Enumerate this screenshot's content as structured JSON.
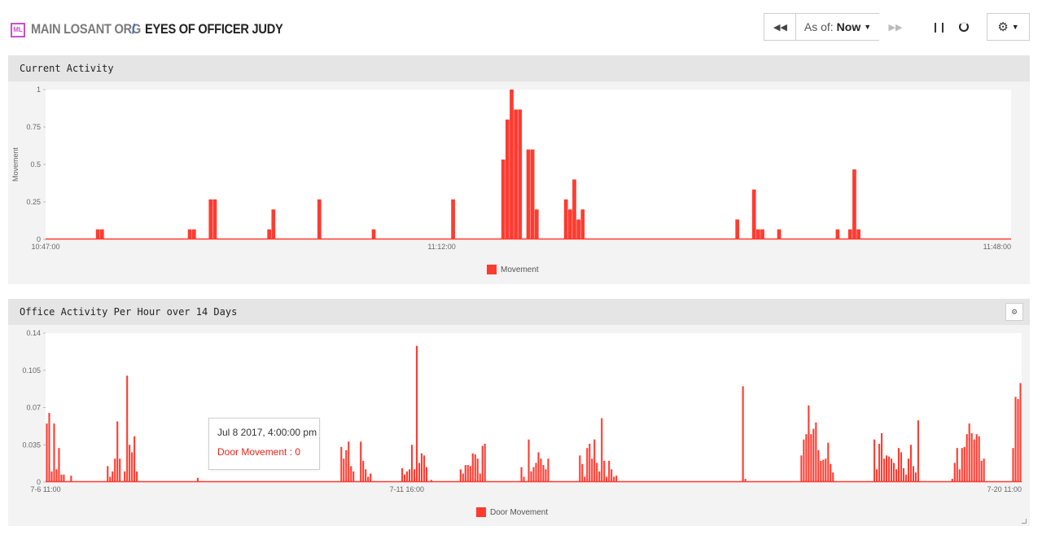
{
  "header": {
    "logo_text": "ML",
    "org_name": "MAIN LOSANT ORG",
    "separator": "/",
    "dashboard_name": "EYES OF OFFICER JUDY",
    "controls": {
      "rewind_icon": "rewind-icon",
      "as_of_label": "As of:",
      "as_of_value": "Now",
      "forward_icon": "fast-forward-icon",
      "pause_icon": "pause-icon",
      "refresh_icon": "loading-spinner-icon",
      "settings_icon": "gear-icon"
    }
  },
  "colors": {
    "bar": "#ff3b30",
    "tooltip_value": "#e8261b",
    "separator": "#2e6bd6",
    "logo": "#c94fd0"
  },
  "panels": [
    {
      "title": "Current Activity",
      "legend": "Movement"
    },
    {
      "title": "Office Activity Per Hour over 14 Days",
      "legend": "Door Movement",
      "tooltip": {
        "date": "Jul 8 2017, 4:00:00 pm",
        "series": "Door Movement",
        "value": "0"
      }
    }
  ],
  "chart_data": [
    {
      "type": "bar",
      "ylabel": "Movement",
      "ylim": [
        0,
        1
      ],
      "yticks": [
        "0",
        "0.25",
        "0.5",
        "0.75",
        "1"
      ],
      "xticks": [
        "10:47:00",
        "11:12:00",
        "11:48:00"
      ],
      "xtick_pos": [
        0,
        0.4103,
        1
      ],
      "legend": "top-bottom-center",
      "series": [
        {
          "name": "Movement",
          "values": [
            0,
            0,
            0,
            0,
            0,
            0,
            0,
            0,
            0,
            0,
            0,
            0,
            0.067,
            0.067,
            0,
            0,
            0,
            0,
            0,
            0,
            0,
            0,
            0,
            0,
            0,
            0,
            0,
            0,
            0,
            0,
            0,
            0,
            0,
            0,
            0.067,
            0.067,
            0,
            0,
            0,
            0.267,
            0.267,
            0,
            0,
            0,
            0,
            0,
            0,
            0,
            0,
            0,
            0,
            0,
            0,
            0.067,
            0.2,
            0,
            0,
            0,
            0,
            0,
            0,
            0,
            0,
            0,
            0,
            0.267,
            0,
            0,
            0,
            0,
            0,
            0,
            0,
            0,
            0,
            0,
            0,
            0,
            0.067,
            0,
            0,
            0,
            0,
            0,
            0,
            0,
            0,
            0,
            0,
            0,
            0,
            0,
            0,
            0,
            0,
            0,
            0,
            0.267,
            0,
            0,
            0,
            0,
            0,
            0,
            0,
            0,
            0,
            0,
            0,
            0.533,
            0.8,
            1,
            0.867,
            0.867,
            0,
            0.6,
            0.6,
            0.2,
            0,
            0,
            0,
            0,
            0,
            0,
            0.267,
            0.2,
            0.4,
            0.133,
            0.2,
            0,
            0,
            0,
            0,
            0,
            0,
            0,
            0,
            0,
            0,
            0,
            0,
            0,
            0,
            0,
            0,
            0,
            0,
            0,
            0,
            0,
            0,
            0,
            0,
            0,
            0,
            0,
            0,
            0,
            0,
            0,
            0,
            0,
            0,
            0,
            0,
            0.133,
            0,
            0,
            0,
            0.333,
            0.067,
            0.067,
            0,
            0,
            0,
            0.067,
            0,
            0,
            0,
            0,
            0,
            0,
            0,
            0,
            0,
            0,
            0,
            0,
            0,
            0.067,
            0,
            0,
            0.067,
            0.467,
            0.067,
            0,
            0,
            0,
            0,
            0,
            0,
            0,
            0,
            0,
            0,
            0,
            0,
            0,
            0,
            0,
            0,
            0,
            0,
            0,
            0,
            0,
            0,
            0,
            0,
            0,
            0,
            0,
            0,
            0,
            0,
            0,
            0,
            0,
            0,
            0,
            0
          ]
        }
      ]
    },
    {
      "type": "bar",
      "ylim": [
        0,
        0.14
      ],
      "yticks": [
        "0",
        "0.035",
        "0.07",
        "0.105",
        "0.14"
      ],
      "xticks": [
        "7-6 11:00",
        "7-11 16:00",
        "7-20 11:00"
      ],
      "xtick_pos": [
        0,
        0.3702,
        1
      ],
      "legend": "bottom-center",
      "series": [
        {
          "name": "Door Movement",
          "values": [
            0.055,
            0.065,
            0.01,
            0.055,
            0.012,
            0.032,
            0.007,
            0.007,
            0,
            0,
            0.006,
            0,
            0,
            0,
            0,
            0,
            0,
            0,
            0,
            0,
            0,
            0,
            0,
            0,
            0,
            0.015,
            0.005,
            0.01,
            0.022,
            0.057,
            0.022,
            0,
            0.01,
            0.1,
            0.035,
            0.028,
            0.043,
            0.01,
            0,
            0,
            0,
            0,
            0,
            0,
            0,
            0,
            0,
            0,
            0,
            0,
            0,
            0,
            0,
            0,
            0,
            0,
            0,
            0,
            0,
            0,
            0,
            0,
            0.004,
            0,
            0,
            0,
            0,
            0,
            0,
            0,
            0,
            0,
            0,
            0,
            0,
            0,
            0,
            0,
            0,
            0,
            0,
            0,
            0,
            0,
            0,
            0,
            0,
            0,
            0,
            0,
            0,
            0,
            0,
            0,
            0,
            0,
            0,
            0,
            0,
            0,
            0,
            0,
            0,
            0,
            0,
            0,
            0,
            0,
            0,
            0,
            0,
            0,
            0,
            0,
            0,
            0,
            0,
            0,
            0,
            0,
            0,
            0.033,
            0.022,
            0.03,
            0.038,
            0.015,
            0.01,
            0,
            0,
            0.038,
            0.02,
            0.012,
            0.005,
            0.008,
            0,
            0,
            0,
            0,
            0,
            0,
            0,
            0,
            0,
            0,
            0,
            0,
            0.013,
            0.007,
            0.01,
            0.012,
            0.035,
            0.012,
            0.128,
            0.018,
            0.027,
            0.025,
            0.014,
            0,
            0.002,
            0,
            0,
            0,
            0,
            0,
            0,
            0,
            0,
            0,
            0,
            0,
            0.012,
            0.008,
            0.016,
            0.016,
            0.015,
            0.027,
            0.026,
            0.022,
            0.008,
            0.034,
            0.036,
            0,
            0,
            0,
            0,
            0,
            0,
            0,
            0,
            0,
            0,
            0,
            0,
            0,
            0,
            0.014,
            0.005,
            0,
            0.04,
            0.01,
            0.014,
            0.018,
            0.028,
            0.022,
            0.016,
            0.012,
            0.022,
            0,
            0,
            0,
            0,
            0,
            0,
            0,
            0,
            0,
            0,
            0,
            0,
            0.025,
            0.017,
            0.005,
            0.032,
            0.036,
            0.022,
            0.04,
            0.018,
            0.01,
            0.06,
            0.02,
            0.005,
            0.02,
            0.012,
            0.005,
            0.006,
            0,
            0,
            0,
            0,
            0,
            0,
            0,
            0,
            0,
            0,
            0,
            0,
            0,
            0,
            0,
            0,
            0,
            0,
            0,
            0,
            0,
            0,
            0,
            0,
            0,
            0,
            0,
            0,
            0,
            0,
            0,
            0,
            0,
            0,
            0,
            0,
            0,
            0,
            0,
            0,
            0,
            0,
            0,
            0,
            0,
            0,
            0,
            0,
            0,
            0,
            0,
            0.09,
            0.003,
            0,
            0,
            0,
            0,
            0,
            0,
            0,
            0,
            0,
            0,
            0,
            0,
            0,
            0,
            0,
            0,
            0,
            0,
            0,
            0,
            0,
            0,
            0.025,
            0.04,
            0.045,
            0.072,
            0.045,
            0.05,
            0.056,
            0.03,
            0.02,
            0.021,
            0.022,
            0.037,
            0.017,
            0.009,
            0,
            0,
            0,
            0,
            0,
            0,
            0,
            0,
            0,
            0,
            0,
            0,
            0,
            0,
            0,
            0,
            0.04,
            0.012,
            0.036,
            0.046,
            0.022,
            0.025,
            0.024,
            0.022,
            0.018,
            0.012,
            0.032,
            0.028,
            0.013,
            0.007,
            0.022,
            0.035,
            0.015,
            0.009,
            0.058,
            0,
            0,
            0,
            0,
            0,
            0,
            0,
            0,
            0,
            0,
            0,
            0,
            0,
            0.003,
            0.018,
            0.032,
            0.012,
            0.032,
            0.033,
            0.045,
            0.055,
            0.046,
            0.04,
            0.045,
            0.043,
            0.02,
            0.022,
            0,
            0,
            0,
            0,
            0,
            0,
            0,
            0,
            0,
            0,
            0,
            0.032,
            0.08,
            0.078,
            0.093
          ]
        }
      ]
    }
  ]
}
